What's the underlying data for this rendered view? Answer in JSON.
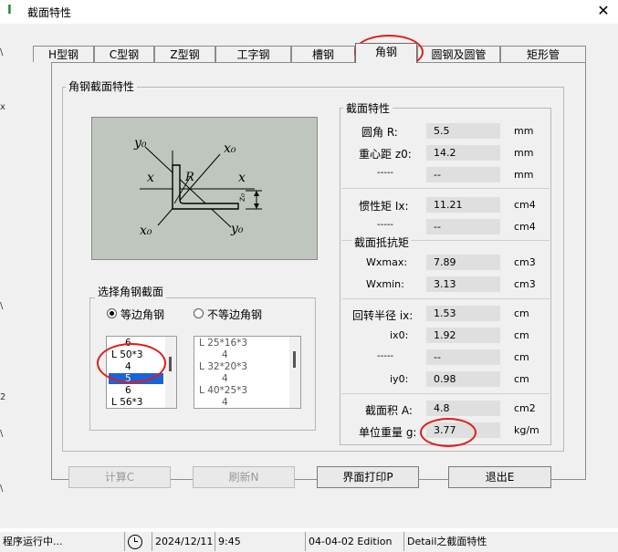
{
  "window": {
    "title": "截面特性",
    "close_glyph": "✕",
    "app_glyph": "I"
  },
  "edge_fragments": [
    "\\",
    "x",
    "\\",
    "2",
    "\\",
    "\\"
  ],
  "tabs": [
    {
      "label": "H型钢",
      "active": false
    },
    {
      "label": "C型钢",
      "active": false
    },
    {
      "label": "Z型钢",
      "active": false
    },
    {
      "label": "工字钢",
      "active": false
    },
    {
      "label": "槽钢",
      "active": false
    },
    {
      "label": "角钢",
      "active": true
    },
    {
      "label": "圆钢及圆管",
      "active": false
    },
    {
      "label": "矩形管",
      "active": false
    }
  ],
  "angle_section": {
    "group_title": "角钢截面特性",
    "diagram_labels": {
      "y0_top": "y₀",
      "x0_top": "x₀",
      "x_left": "x",
      "x_right": "x",
      "R": "R",
      "z0": "z₀",
      "x0_bottom": "x₀",
      "y0_bottom": "y₀"
    }
  },
  "section_props": {
    "title": "截面特性",
    "rows1": [
      {
        "label": "圆角   R:",
        "value": "5.5",
        "unit": "mm"
      },
      {
        "label": "重心距 z0:",
        "value": "14.2",
        "unit": "mm"
      },
      {
        "label": "-----",
        "value": "--",
        "unit": "mm"
      }
    ],
    "rows2": [
      {
        "label": "惯性矩 Ix:",
        "value": "11.21",
        "unit": "cm4"
      },
      {
        "label": "-----",
        "value": "--",
        "unit": "cm4"
      }
    ],
    "modulus_title": "截面抵抗矩",
    "rows3": [
      {
        "label": "Wxmax:",
        "value": "7.89",
        "unit": "cm3"
      },
      {
        "label": "Wxmin:",
        "value": "3.13",
        "unit": "cm3"
      }
    ],
    "rows4": [
      {
        "label": "回转半径 ix:",
        "value": "1.53",
        "unit": "cm"
      },
      {
        "label": "ix0:",
        "value": "1.92",
        "unit": "cm"
      },
      {
        "label": "-----",
        "value": "--",
        "unit": "cm"
      },
      {
        "label": "iy0:",
        "value": "0.98",
        "unit": "cm"
      }
    ],
    "rows5": [
      {
        "label": "截面积 A:",
        "value": "4.8",
        "unit": "cm2"
      },
      {
        "label": "单位重量 g:",
        "value": "3.77",
        "unit": "kg/m"
      }
    ]
  },
  "selector": {
    "title": "选择角钢截面",
    "radio_equal": "等边角钢",
    "radio_unequal": "不等边角钢",
    "list_equal": [
      "6",
      "L 50*3",
      "4",
      "5",
      "6",
      "L 56*3"
    ],
    "selected_index": 3,
    "list_unequal": [
      "L 25*16*3",
      "4",
      "L 32*20*3",
      "4",
      "L 40*25*3",
      "4"
    ]
  },
  "buttons": {
    "calc": "计算C",
    "refresh": "刷新N",
    "print": "界面打印P",
    "exit": "退出E"
  },
  "status": {
    "state": "程序运行中...",
    "date": "2024/12/11",
    "time": "9:45",
    "edition": "04-04-02 Edition",
    "detail": "Detail之截面特性"
  }
}
